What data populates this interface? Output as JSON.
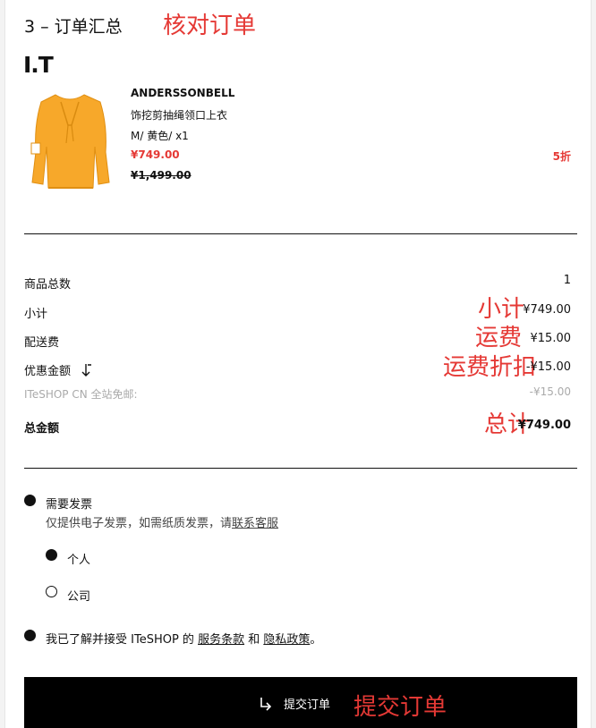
{
  "header": {
    "step_title": "3 – 订单汇总",
    "annotation": "核对订单",
    "logo": "I.T"
  },
  "product": {
    "brand": "ANDERSSONBELL",
    "name": "饰挖剪抽绳领口上衣",
    "variant": "M/ 黄色/ x1",
    "price": "¥749.00",
    "original_price": "¥1,499.00",
    "discount": "5折",
    "image_color": "#f7a82a"
  },
  "summary": {
    "item_count_label": "商品总数",
    "item_count_value": "1",
    "subtotal_label": "小计",
    "subtotal_annotation": "小计",
    "subtotal_value": "¥749.00",
    "shipping_label": "配送费",
    "shipping_annotation": "运费",
    "shipping_value": "¥15.00",
    "discount_label": "优惠金额",
    "discount_annotation": "运费折扣",
    "discount_value": "-¥15.00",
    "promo_label": "ITeSHOP CN 全站免邮:",
    "promo_value": "-¥15.00",
    "total_label": "总金额",
    "total_annotation": "总计",
    "total_value": "¥749.00"
  },
  "invoice": {
    "need_invoice_label": "需要发票",
    "note_prefix": "仅提供电子发票，如需纸质发票，请",
    "note_link": "联系客服",
    "option_personal": "个人",
    "option_company": "公司",
    "selected": "个人"
  },
  "terms": {
    "prefix": "我已了解并接受 ITeSHOP 的 ",
    "service_link": "服务条款",
    "and": " 和 ",
    "privacy_link": "隐私政策",
    "suffix": "。"
  },
  "submit": {
    "label": "提交订单",
    "annotation": "提交订单",
    "icon": "arrow-turn-icon"
  },
  "colors": {
    "accent_red": "#e53935",
    "button_bg": "#000000",
    "muted": "#aaaaaa"
  }
}
